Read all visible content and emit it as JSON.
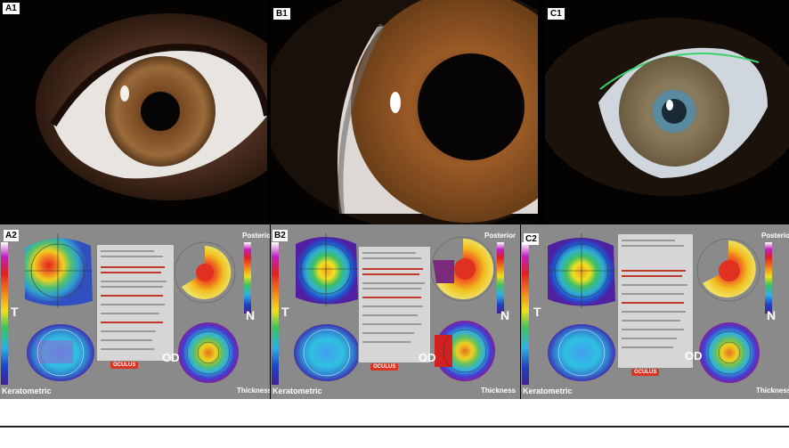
{
  "photos": [
    {
      "label": "A1"
    },
    {
      "label": "B1"
    },
    {
      "label": "C1"
    }
  ],
  "maps": [
    {
      "label": "A2",
      "left": "T",
      "right": "N",
      "eye": "OD",
      "bottom_left": "Keratometric",
      "top_right": "Posterior",
      "bottom_right": "Thickness",
      "logo": "OCULUS"
    },
    {
      "label": "B2",
      "left": "T",
      "right": "N",
      "eye": "OD",
      "bottom_left": "Keratometric",
      "top_right": "Posterior",
      "bottom_right": "Thickness",
      "logo": "OCULUS"
    },
    {
      "label": "C2",
      "left": "T",
      "right": "N",
      "eye": "OD",
      "bottom_left": "Keratometric",
      "top_right": "Posterior",
      "bottom_right": "Thickness",
      "logo": "OCULUS"
    }
  ]
}
